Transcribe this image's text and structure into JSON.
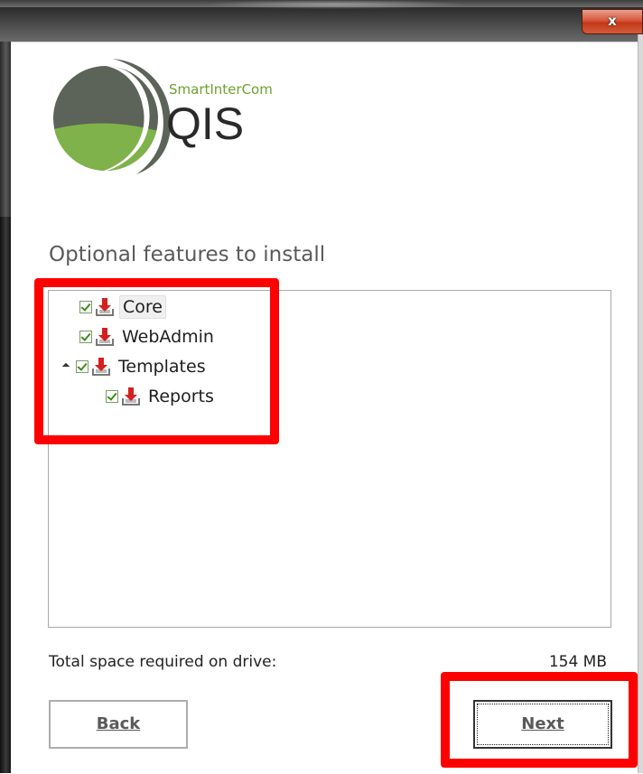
{
  "window": {
    "close_glyph": "x"
  },
  "brand": {
    "company": "SmartInterCom",
    "product": "QIS",
    "colors": {
      "dark": "#5c6358",
      "green": "#7fb24a"
    }
  },
  "features": {
    "title": "Optional features to install",
    "items": [
      {
        "label": "Core",
        "checked": true,
        "icon": "install-icon",
        "level": 0,
        "expander": false,
        "selected": true
      },
      {
        "label": "WebAdmin",
        "checked": true,
        "icon": "install-icon",
        "level": 0,
        "expander": false,
        "selected": false
      },
      {
        "label": "Templates",
        "checked": true,
        "icon": "install-icon",
        "level": 0,
        "expander": true,
        "selected": false
      },
      {
        "label": "Reports",
        "checked": true,
        "icon": "install-icon",
        "level": 1,
        "expander": false,
        "selected": false
      }
    ]
  },
  "space": {
    "label": "Total space required on drive:",
    "value": "154 MB"
  },
  "buttons": {
    "back": "Back",
    "next": "Next"
  },
  "annotations": {
    "highlight_color": "#ff0000"
  }
}
